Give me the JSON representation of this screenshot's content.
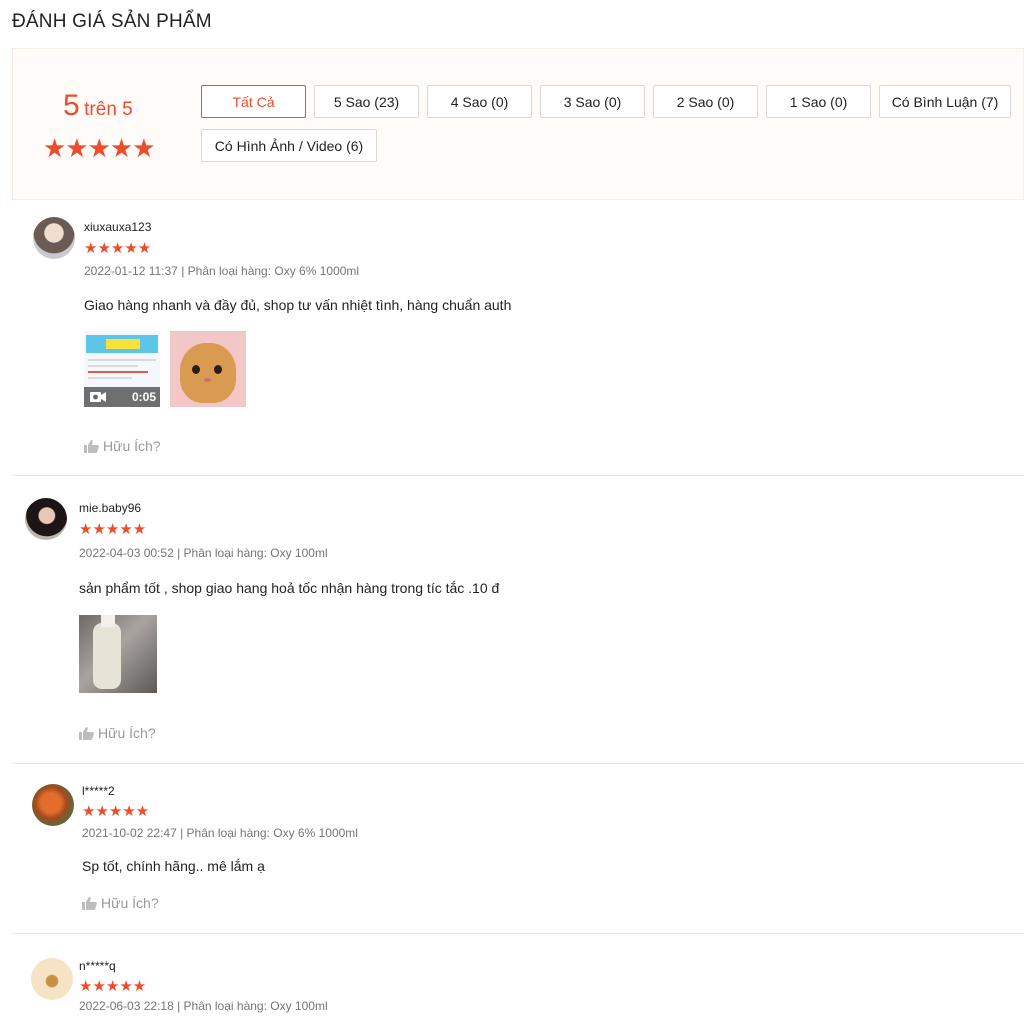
{
  "page_title": "ĐÁNH GIÁ SẢN PHẨM",
  "overview": {
    "score": "5",
    "score_suffix": "trên 5",
    "stars": "★★★★★",
    "rating_value": 5
  },
  "filters": [
    {
      "label": "Tất Cả",
      "active": true
    },
    {
      "label": "5 Sao (23)",
      "active": false
    },
    {
      "label": "4 Sao (0)",
      "active": false
    },
    {
      "label": "3 Sao (0)",
      "active": false
    },
    {
      "label": "2 Sao (0)",
      "active": false
    },
    {
      "label": "1 Sao (0)",
      "active": false
    },
    {
      "label": "Có Bình Luận (7)",
      "active": false
    },
    {
      "label": "Có Hình Ảnh / Video (6)",
      "active": false
    }
  ],
  "reviews": [
    {
      "username": "xiuxauxa123",
      "stars": "★★★★★",
      "rating": 5,
      "meta": "2022-01-12 11:37 | Phân loại hàng: Oxy 6% 1000ml",
      "comment": "Giao hàng nhanh và đầy đủ, shop tư vấn nhiệt tình, hàng chuẩn auth",
      "video_duration": "0:05",
      "helpful": "Hữu Ích?"
    },
    {
      "username": "mie.baby96",
      "stars": "★★★★★",
      "rating": 5,
      "meta": "2022-04-03 00:52 | Phân loại hàng: Oxy 100ml",
      "comment": "sản phẩm tốt , shop giao hang hoả tốc nhận hàng trong tíc tắc .10 đ",
      "helpful": "Hữu Ích?"
    },
    {
      "username": "l*****2",
      "stars": "★★★★★",
      "rating": 5,
      "meta": "2021-10-02 22:47 | Phân loại hàng: Oxy 6% 1000ml",
      "comment": "Sp tốt, chính hãng.. mê lắm ạ",
      "helpful": "Hữu Ích?"
    },
    {
      "username": "n*****q",
      "stars": "★★★★★",
      "rating": 5,
      "meta": "2022-06-03 22:18 | Phân loại hàng: Oxy 100ml"
    }
  ],
  "colors": {
    "accent": "#ee4d2d",
    "overview_bg": "#fffbf8",
    "muted_text": "#757575"
  },
  "icons": {
    "thumb": "thumbs-up-icon",
    "video": "video-camera-icon",
    "star": "star-icon"
  }
}
